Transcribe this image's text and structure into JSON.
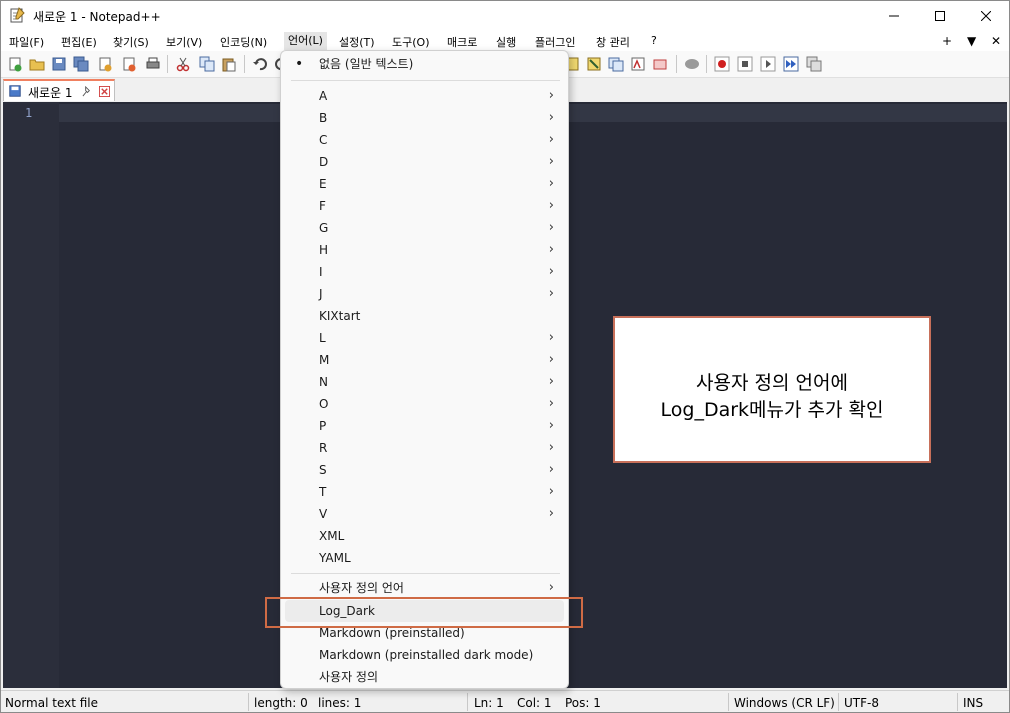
{
  "window": {
    "title": "새로운 1 - Notepad++"
  },
  "menubar": {
    "items": [
      {
        "label": "파일(F)"
      },
      {
        "label": "편집(E)"
      },
      {
        "label": "찾기(S)"
      },
      {
        "label": "보기(V)"
      },
      {
        "label": "인코딩(N)"
      },
      {
        "label": "언어(L)"
      },
      {
        "label": "설정(T)"
      },
      {
        "label": "도구(O)"
      },
      {
        "label": "매크로"
      },
      {
        "label": "실행"
      },
      {
        "label": "플러그인"
      },
      {
        "label": "창 관리"
      },
      {
        "label": "?"
      }
    ],
    "right": {
      "plus": "+",
      "down": "▼",
      "close": "✕"
    }
  },
  "tab": {
    "label": "새로운 1"
  },
  "editor": {
    "line_number": "1"
  },
  "language_menu": {
    "none_item": "없음 (일반 텍스트)",
    "letters": [
      "A",
      "B",
      "C",
      "D",
      "E",
      "F",
      "G",
      "H",
      "I",
      "J"
    ],
    "kixtart": "KIXtart",
    "letters2": [
      "L",
      "M",
      "N",
      "O",
      "P",
      "R",
      "S",
      "T",
      "V"
    ],
    "xml": "XML",
    "yaml": "YAML",
    "user_defined_submenu": "사용자 정의 언어",
    "log_dark": "Log_Dark",
    "markdown": "Markdown (preinstalled)",
    "markdown_dark": "Markdown (preinstalled dark mode)",
    "user_defined": "사용자 정의",
    "arrow": "›"
  },
  "statusbar": {
    "file_type": "Normal text file",
    "length": "length: 0",
    "lines": "lines: 1",
    "ln": "Ln: 1",
    "col": "Col: 1",
    "pos": "Pos: 1",
    "eol": "Windows (CR LF)",
    "encoding": "UTF-8",
    "mode": "INS"
  },
  "annotation": {
    "line1": "사용자 정의 언어에",
    "line2": "Log_Dark메뉴가 추가 확인"
  },
  "colors": {
    "editor_bg": "#272a37",
    "accent": "#cf6b45"
  }
}
